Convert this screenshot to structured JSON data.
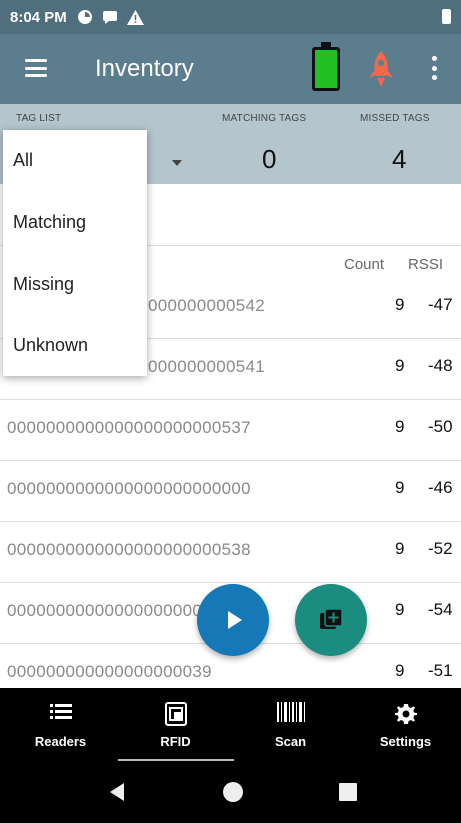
{
  "status_bar": {
    "time": "8:04 PM",
    "icons": [
      "data-saver-icon",
      "message-icon",
      "warning-icon",
      "battery-icon"
    ]
  },
  "app_bar": {
    "title": "Inventory",
    "icons": [
      "menu-icon",
      "battery-icon",
      "rocket-icon",
      "overflow-menu-icon"
    ],
    "battery_color": "#20c020",
    "rocket_color": "#f06a4a"
  },
  "summary": {
    "tag_list_label": "TAG LIST",
    "matching_tags_label": "MATCHING TAGS",
    "matching_tags_value": "0",
    "missed_tags_label": "MISSED TAGS",
    "missed_tags_value": "4"
  },
  "tag_list_popup": {
    "options": [
      "All",
      "Matching",
      "Missing",
      "Unknown"
    ]
  },
  "list": {
    "headers": {
      "count": "Count",
      "rssi": "RSSI"
    },
    "rows": [
      {
        "tag": "000000000542",
        "count": "9",
        "rssi": "-47"
      },
      {
        "tag": "000000000541",
        "count": "9",
        "rssi": "-48"
      },
      {
        "tag": "0000000000000000000000537",
        "count": "9",
        "rssi": "-50"
      },
      {
        "tag": "0000000000000000000000000",
        "count": "9",
        "rssi": "-46"
      },
      {
        "tag": "0000000000000000000000538",
        "count": "9",
        "rssi": "-52"
      },
      {
        "tag": "0000000000000000000000555",
        "count": "9",
        "rssi": "-54"
      },
      {
        "tag": "000000000000000000039",
        "count": "9",
        "rssi": "-51"
      }
    ]
  },
  "fabs": {
    "play_color": "#1678b6",
    "add_color": "#1b8c80"
  },
  "bottom_nav": {
    "items": [
      {
        "label": "Readers",
        "icon": "list-icon"
      },
      {
        "label": "RFID",
        "icon": "rfid-icon"
      },
      {
        "label": "Scan",
        "icon": "barcode-icon"
      },
      {
        "label": "Settings",
        "icon": "gear-icon"
      }
    ],
    "selected": "RFID"
  }
}
